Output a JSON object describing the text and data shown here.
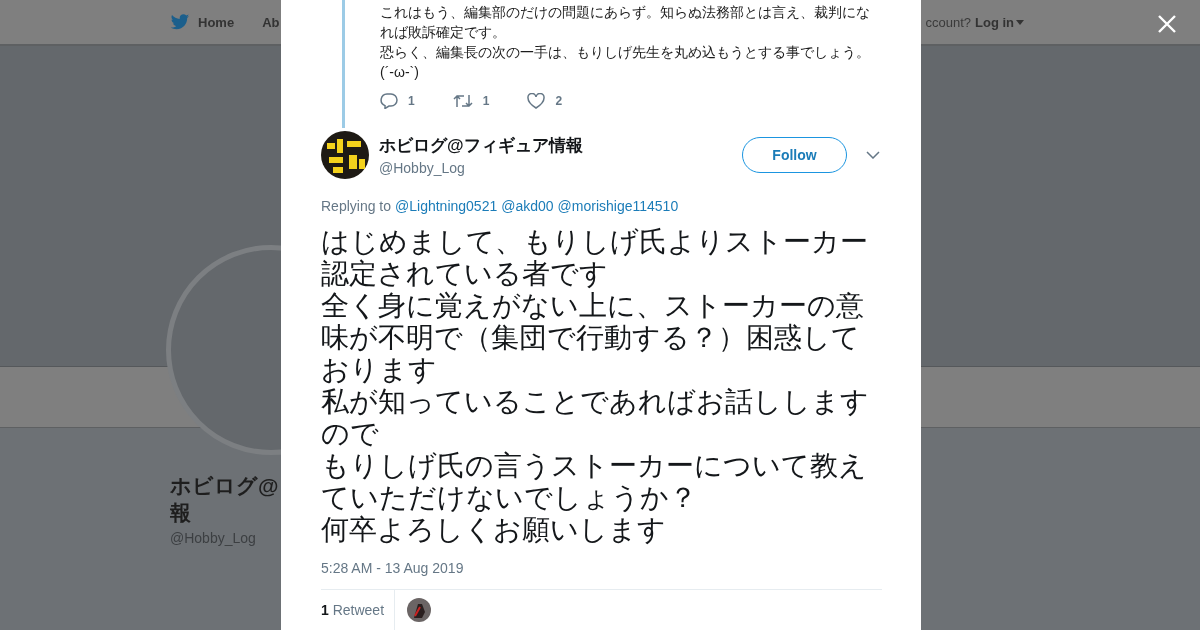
{
  "background_page": {
    "nav": {
      "home": "Home",
      "about": "Ab",
      "account_prompt": "ccount?",
      "login": "Log in"
    },
    "profile": {
      "name_lines": [
        "ホビログ@",
        "報"
      ],
      "handle": "@Hobby_Log"
    }
  },
  "modal": {
    "parent_tweet": {
      "lines": [
        "これはもう、編集部のだけの問題にあらず。知らぬ法務部とは言え、裁判になれば敗訴確定です。",
        "恐らく、編集長の次の一手は、もりしげ先生を丸め込もうとする事でしょう。(´-ω-`)"
      ],
      "actions": [
        {
          "kind": "reply",
          "count": "1"
        },
        {
          "kind": "retweet",
          "count": "1"
        },
        {
          "kind": "like",
          "count": "2"
        }
      ]
    },
    "tweet": {
      "name": "ホビログ@フィギュア情報",
      "handle": "@Hobby_Log",
      "follow_button": "Follow",
      "replying_label": "Replying to",
      "replying_to": [
        "@Lightning0521",
        "@akd00",
        "@morishige114510"
      ],
      "lines": [
        "はじめまして、もりしげ氏よりストーカー認定されている者です",
        "全く身に覚えがない上に、ストーカーの意味が不明で（集団で行動する？）困惑しております",
        "私が知っていることであればお話ししますので",
        "もりしげ氏の言うストーカーについて教えていただけないでしょうか？",
        "何卒よろしくお願いします"
      ],
      "timestamp": "5:28 AM - 13 Aug 2019",
      "retweets": {
        "count": "1",
        "label": "Retweet"
      }
    }
  }
}
